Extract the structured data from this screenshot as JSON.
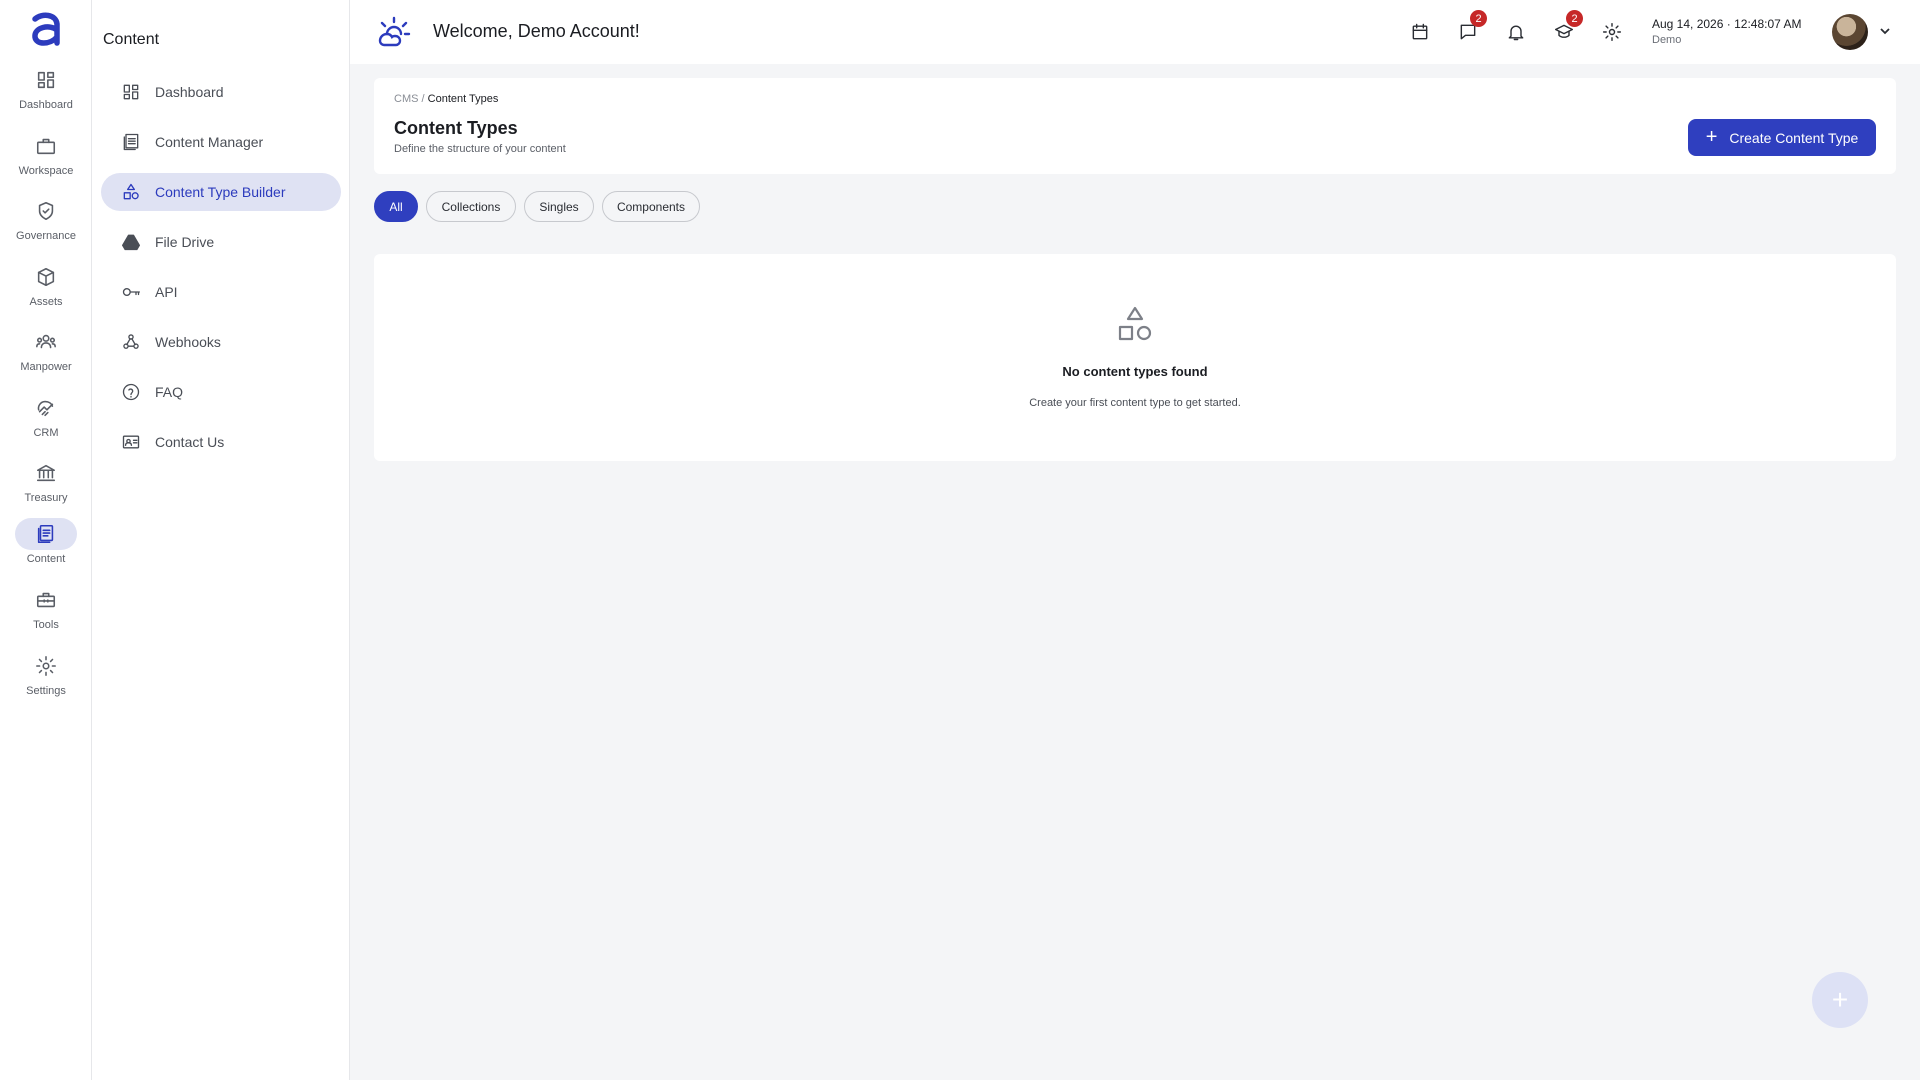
{
  "rail": {
    "items": [
      {
        "label": "Dashboard",
        "icon": "dashboard-icon"
      },
      {
        "label": "Workspace",
        "icon": "briefcase-icon"
      },
      {
        "label": "Governance",
        "icon": "shield-check-icon"
      },
      {
        "label": "Assets",
        "icon": "cube-icon"
      },
      {
        "label": "Manpower",
        "icon": "people-icon"
      },
      {
        "label": "CRM",
        "icon": "handshake-icon"
      },
      {
        "label": "Treasury",
        "icon": "bank-icon"
      },
      {
        "label": "Content",
        "icon": "document-icon"
      },
      {
        "label": "Tools",
        "icon": "toolbox-icon"
      },
      {
        "label": "Settings",
        "icon": "gear-icon"
      }
    ],
    "active": "Content"
  },
  "sidebar": {
    "title": "Content",
    "items": [
      {
        "label": "Dashboard",
        "icon": "dashboard-icon"
      },
      {
        "label": "Content Manager",
        "icon": "list-document-icon"
      },
      {
        "label": "Content Type Builder",
        "icon": "shapes-icon"
      },
      {
        "label": "File Drive",
        "icon": "drive-icon"
      },
      {
        "label": "API",
        "icon": "key-icon"
      },
      {
        "label": "Webhooks",
        "icon": "webhook-icon"
      },
      {
        "label": "FAQ",
        "icon": "help-circle-icon"
      },
      {
        "label": "Contact Us",
        "icon": "contact-card-icon"
      }
    ],
    "active": "Content Type Builder"
  },
  "header": {
    "title": "Welcome, Demo Account!",
    "messages_badge": "2",
    "learning_badge": "2",
    "date": "Aug 14, 2026",
    "separator": "·",
    "time": "12:48:07 AM",
    "account": "Demo"
  },
  "page": {
    "breadcrumb_root": "CMS",
    "breadcrumb_sep": "/",
    "breadcrumb_current": "Content Types",
    "title": "Content Types",
    "description": "Define the structure of your content",
    "create_button": "Create Content Type",
    "create_plus": "+"
  },
  "tabs": [
    {
      "label": "All"
    },
    {
      "label": "Collections"
    },
    {
      "label": "Singles"
    },
    {
      "label": "Components"
    }
  ],
  "active_tab": "All",
  "empty": {
    "title": "No content types found",
    "description": "Create your first content type to get started."
  },
  "fab": {
    "symbol": "+"
  },
  "colors": {
    "accent": "#2f3fbf",
    "active_bg": "#dfe2f3",
    "badge": "#c62828",
    "background": "#f4f5f7"
  }
}
